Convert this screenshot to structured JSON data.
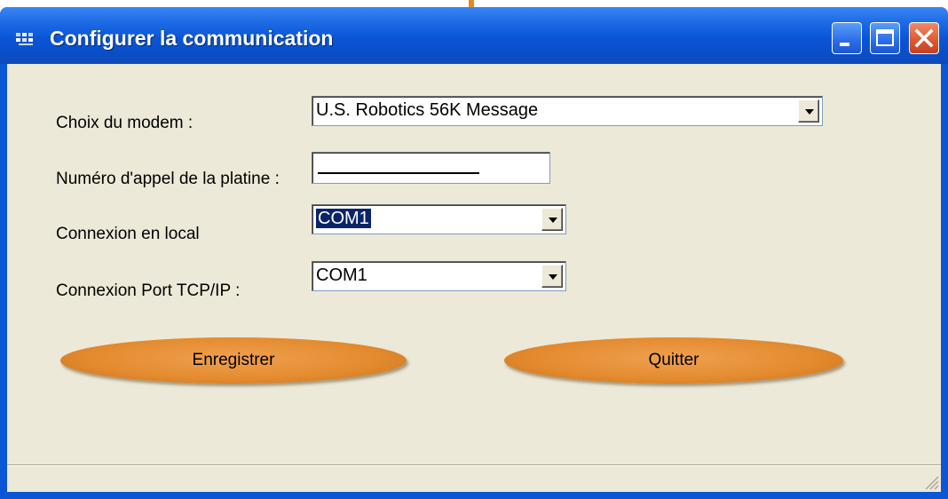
{
  "window": {
    "title": "Configurer la communication",
    "controls": {
      "minimize": "minimize-icon",
      "maximize": "maximize-icon",
      "close": "close-icon"
    }
  },
  "form": {
    "modem": {
      "label": "Choix du modem :",
      "value": "U.S. Robotics 56K Message"
    },
    "phone": {
      "label": "Numéro d'appel de la platine :",
      "value": ""
    },
    "local": {
      "label": "Connexion en local",
      "value": "COM1"
    },
    "tcpip": {
      "label": "Connexion Port TCP/IP :",
      "value": "COM1"
    }
  },
  "buttons": {
    "save": "Enregistrer",
    "quit": "Quitter"
  },
  "colors": {
    "titlebar": "#0a55d6",
    "client": "#ece9d8",
    "button_orange": "#e38a2e",
    "selection": "#0a246a"
  }
}
